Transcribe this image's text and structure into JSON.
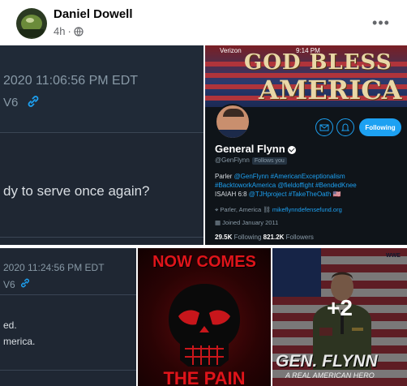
{
  "post": {
    "author": "Daniel Dowell",
    "time": "4h",
    "separator": "·",
    "more": "•••"
  },
  "tile1": {
    "timestamp": "2020 11:06:56 PM EDT",
    "v6": "V6",
    "question": "dy to serve once again?"
  },
  "tile2": {
    "carrier": "Verizon",
    "time": "9:14 PM",
    "banner_line1": "GOD BLESS",
    "banner_line2": "AMERICA",
    "follow_label": "Following",
    "name": "General Flynn",
    "handle": "@GenFlynn",
    "follows_you": "Follows you",
    "bio_parler": "Parler ",
    "bio_parler_tag": "@GenFlynn #AmericanExceptionalism",
    "bio_line2": "#BacktoworkAmerica @fieldoffight #BendedKnee",
    "bio_isaiah": "ISAIAH 6:8 ",
    "bio_isaiah_tags": "@TJHproject #TakeTheOath 🇺🇸",
    "location": "Parler, America",
    "website": "mikeflynndefensefund.org",
    "joined": "Joined January 2011",
    "following_count": "29.5K",
    "following_label": "Following",
    "followers_count": "821.2K",
    "followers_label": "Followers"
  },
  "tile3": {
    "timestamp": "2020 11:24:56 PM EDT",
    "v6": "V6",
    "line1": "ed.",
    "line2": "merica."
  },
  "tile4": {
    "top_text": "NOW COMES",
    "bottom_text": "THE PAIN"
  },
  "tile5": {
    "watermark": "WWE",
    "more_count": "+2",
    "title": "GEN. FLYNN",
    "subtitle": "A REAL AMERICAN HERO"
  },
  "colors": {
    "twitter_blue": "#1da1f2",
    "dark_bg": "#1f2733",
    "red": "#e0141a"
  }
}
